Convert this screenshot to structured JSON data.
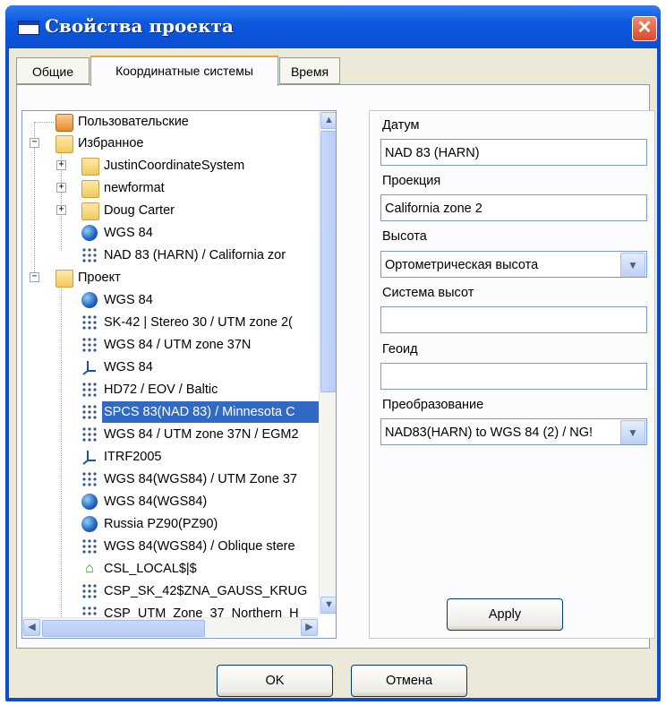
{
  "window": {
    "title": "Свойства проекта",
    "close_glyph": "✕"
  },
  "tabs": [
    {
      "label": "Общие",
      "active": false
    },
    {
      "label": "Координатные системы",
      "active": true
    },
    {
      "label": "Время",
      "active": false
    }
  ],
  "tree": {
    "nodes": [
      {
        "label": "Пользовательские",
        "icon": "user-folder-icon"
      },
      {
        "label": "Избранное",
        "icon": "folder-icon",
        "toggle": "−"
      },
      {
        "label": "JustinCoordinateSystem",
        "icon": "folder-icon",
        "toggle": "+"
      },
      {
        "label": "newformat",
        "icon": "folder-icon",
        "toggle": "+"
      },
      {
        "label": "Doug Carter",
        "icon": "folder-icon",
        "toggle": "+"
      },
      {
        "label": "WGS 84",
        "icon": "globe-icon"
      },
      {
        "label": "NAD 83 (HARN)  /  California zor",
        "icon": "grid-projection-icon"
      },
      {
        "label": "Проект",
        "icon": "folder-icon",
        "toggle": "−"
      },
      {
        "label": "WGS 84",
        "icon": "globe-icon"
      },
      {
        "label": "SK-42 | Stereo 30 / UTM zone 2(",
        "icon": "grid-projection-icon"
      },
      {
        "label": "WGS 84 / UTM zone 37N",
        "icon": "grid-projection-icon"
      },
      {
        "label": "WGS 84",
        "icon": "axis-icon"
      },
      {
        "label": "HD72 / EOV / Baltic",
        "icon": "grid-projection-icon"
      },
      {
        "label": "SPCS 83(NAD 83) / Minnesota C",
        "icon": "grid-projection-icon",
        "selected": true
      },
      {
        "label": "WGS 84 / UTM zone 37N / EGM2",
        "icon": "grid-projection-icon"
      },
      {
        "label": "ITRF2005",
        "icon": "axis-icon"
      },
      {
        "label": "WGS 84(WGS84) / UTM Zone 37",
        "icon": "grid-projection-icon"
      },
      {
        "label": "WGS 84(WGS84)",
        "icon": "globe-icon"
      },
      {
        "label": "Russia PZ90(PZ90)",
        "icon": "globe-icon"
      },
      {
        "label": "WGS 84(WGS84) / Oblique stere",
        "icon": "grid-projection-icon"
      },
      {
        "label": "CSL_LOCAL$|$",
        "icon": "house-icon"
      },
      {
        "label": "CSP_SK_42$ZNA_GAUSS_KRUG",
        "icon": "grid-projection-icon"
      },
      {
        "label": "CSP_UTM_Zone_37_Northern_H",
        "icon": "grid-projection-icon"
      }
    ],
    "scroll_up": "▲",
    "scroll_down": "▼",
    "scroll_left": "◀",
    "scroll_right": "▶"
  },
  "props": {
    "datum_label": "Датум",
    "datum_value": "NAD 83 (HARN)",
    "projection_label": "Проекция",
    "projection_value": "California zone 2",
    "height_label": "Высота",
    "height_value": "Ортометрическая высота",
    "height_system_label": "Система высот",
    "height_system_value": "",
    "geoid_label": "Геоид",
    "geoid_value": "",
    "transform_label": "Преобразование",
    "transform_value": "NAD83(HARN) to WGS 84 (2) / NG!",
    "dropdown_glyph": "▼",
    "apply_label": "Apply"
  },
  "footer": {
    "ok_label": "OK",
    "cancel_label": "Отмена"
  },
  "colors": {
    "title_bar": "#0a4fd0",
    "selection": "#316ac5",
    "dialog_bg": "#ece9d8"
  }
}
